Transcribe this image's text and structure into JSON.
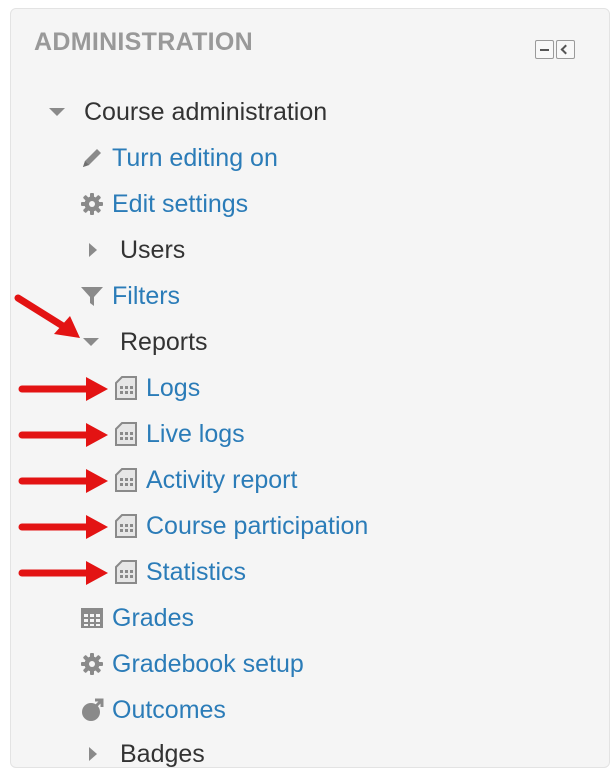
{
  "block": {
    "title": "ADMINISTRATION",
    "hide_icon": "minus-box-icon",
    "dock_icon": "dock-left-icon"
  },
  "tree": {
    "course_admin": "Course administration",
    "turn_editing": "Turn editing on",
    "edit_settings": "Edit settings",
    "users": "Users",
    "filters": "Filters",
    "reports": "Reports",
    "reports_items": [
      "Logs",
      "Live logs",
      "Activity report",
      "Course participation",
      "Statistics"
    ],
    "grades": "Grades",
    "gradebook_setup": "Gradebook setup",
    "outcomes": "Outcomes",
    "badges": "Badges"
  },
  "colors": {
    "link": "#2b7cb8",
    "text": "#333333",
    "title": "#999999",
    "annotation_arrow": "#e31313"
  }
}
